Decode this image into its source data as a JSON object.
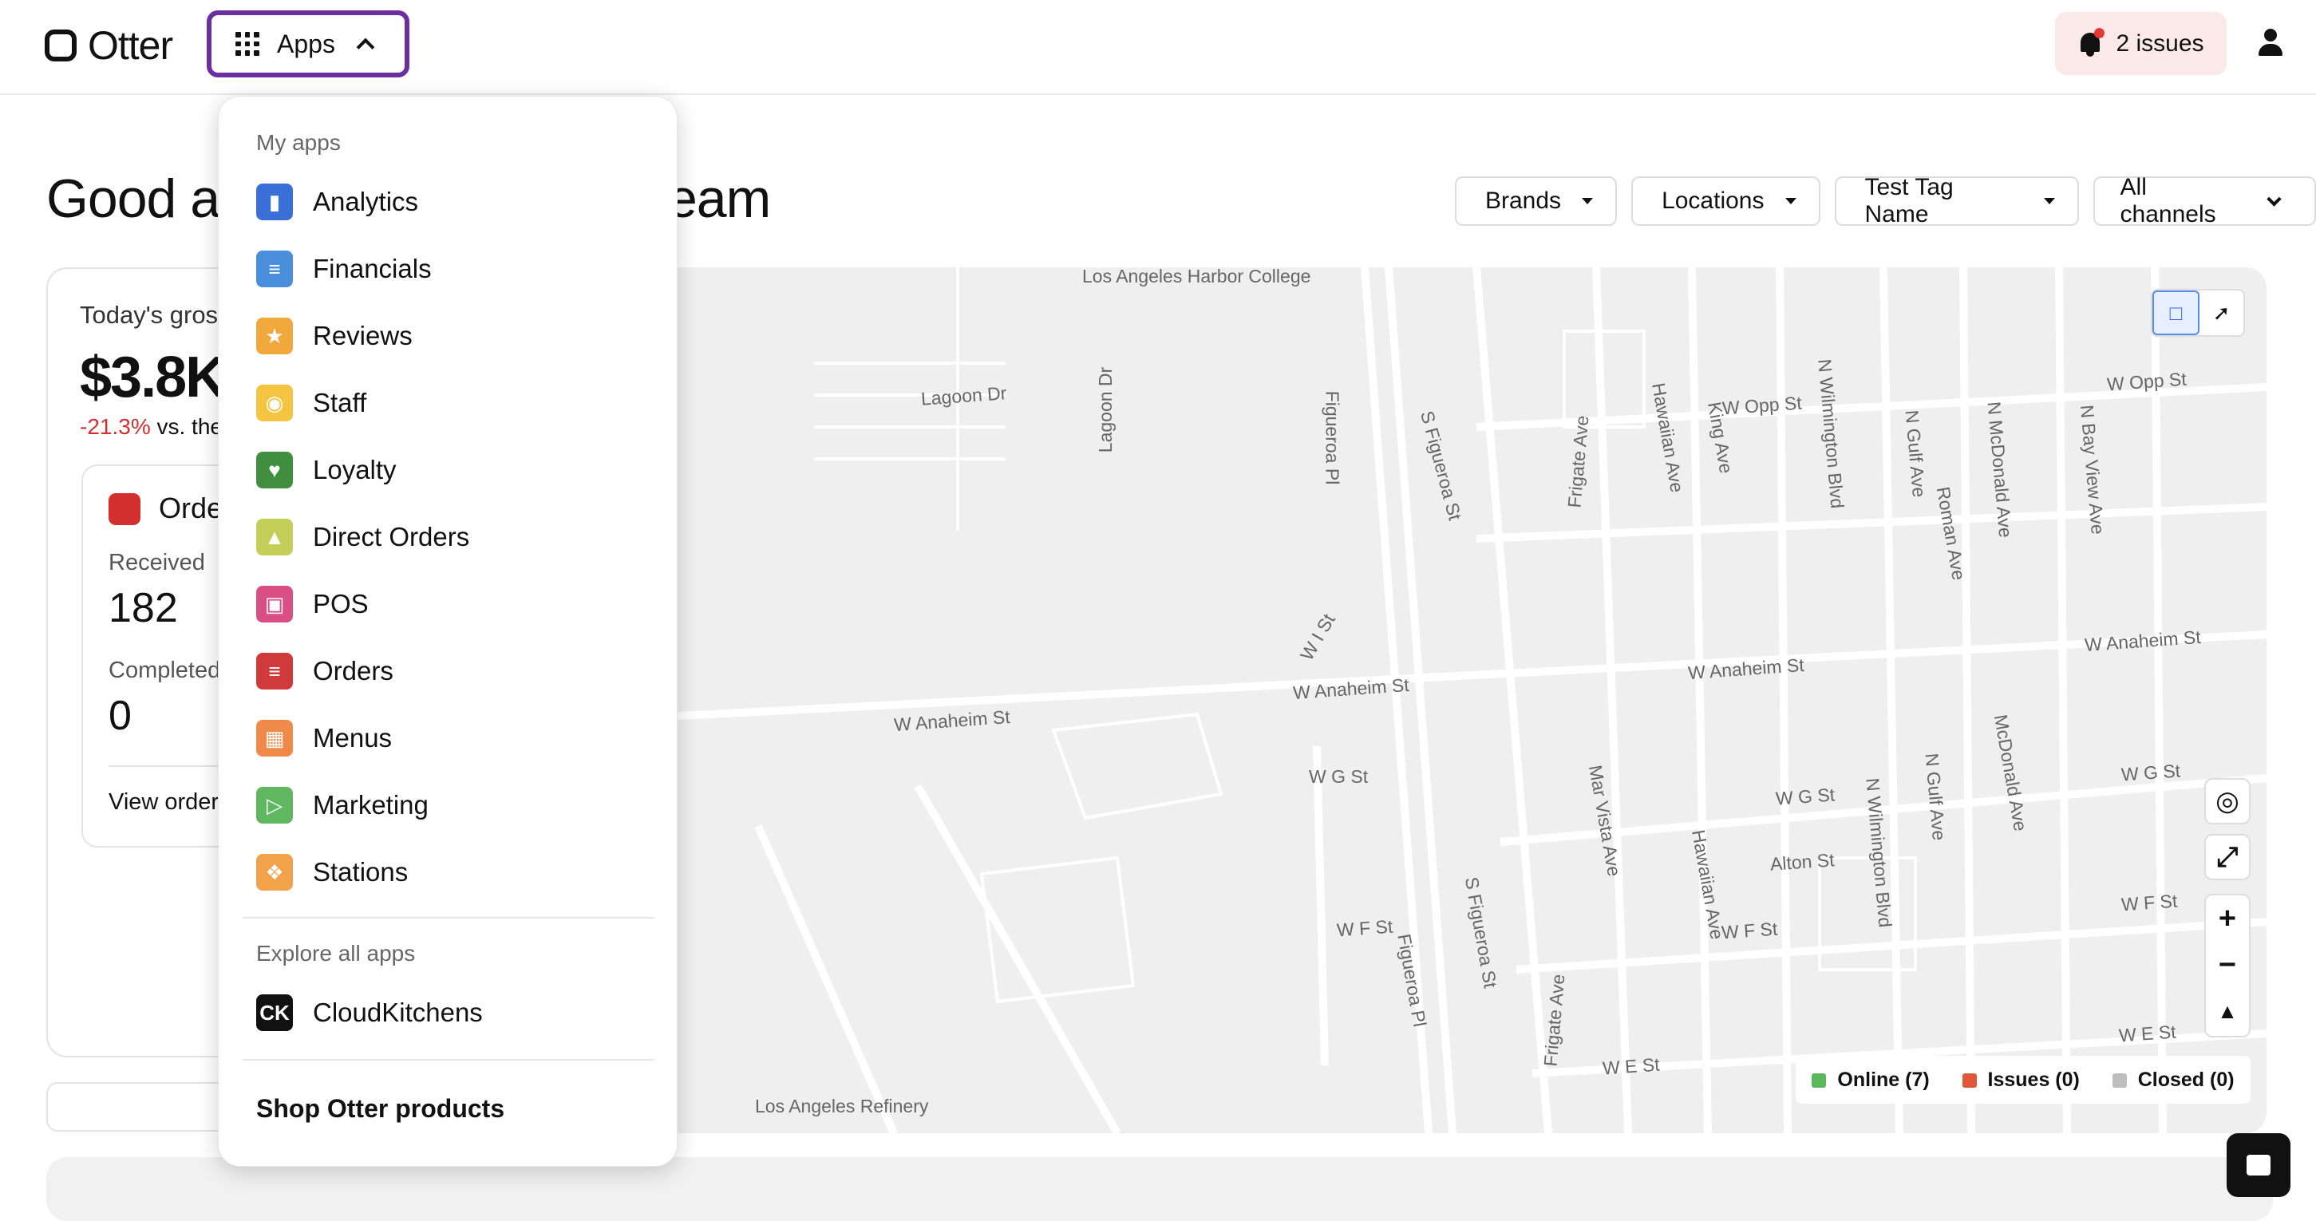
{
  "header": {
    "logo_text": "Otter",
    "apps_label": "Apps",
    "issues_label": "2 issues"
  },
  "greeting": "Good afternoon, Training Team",
  "filters": [
    "Brands",
    "Locations",
    "Test Tag Name",
    "All channels"
  ],
  "summary": {
    "label": "Today's gross sales",
    "value": "$3.8K",
    "change": "-21.3%",
    "change_suffix": "vs. the same day last week"
  },
  "orders_card": {
    "title": "Orders",
    "received_label": "Received",
    "received_value": "182",
    "completed_label": "Completed",
    "completed_value": "0",
    "view_link": "View orders"
  },
  "apps_menu": {
    "my_apps_heading": "My apps",
    "items": [
      {
        "label": "Analytics",
        "icon": "analytics-icon",
        "color": "#3b6fd8"
      },
      {
        "label": "Financials",
        "icon": "financials-icon",
        "color": "#4a8fdb"
      },
      {
        "label": "Reviews",
        "icon": "star-icon",
        "color": "#f2a93b"
      },
      {
        "label": "Staff",
        "icon": "staff-icon",
        "color": "#f5c542"
      },
      {
        "label": "Loyalty",
        "icon": "heart-icon",
        "color": "#3f8f3f"
      },
      {
        "label": "Direct Orders",
        "icon": "cloche-icon",
        "color": "#c4cf5a"
      },
      {
        "label": "POS",
        "icon": "pos-icon",
        "color": "#d94f84"
      },
      {
        "label": "Orders",
        "icon": "orders-icon",
        "color": "#d13a3a"
      },
      {
        "label": "Menus",
        "icon": "menus-icon",
        "color": "#ef8a4a"
      },
      {
        "label": "Marketing",
        "icon": "megaphone-icon",
        "color": "#5fb85f"
      },
      {
        "label": "Stations",
        "icon": "stations-icon",
        "color": "#f2a24a"
      }
    ],
    "explore_heading": "Explore all apps",
    "explore_items": [
      {
        "label": "CloudKitchens",
        "icon": "cloudkitchens-icon",
        "badge": "CK",
        "color": "#111111"
      }
    ],
    "shop_label": "Shop Otter products"
  },
  "map": {
    "labels": [
      "Los Angeles Harbor College",
      "Lagoon Dr",
      "Lagoon Dr",
      "Figueroa Pl",
      "S Figueroa St",
      "Frigate Ave",
      "Hawaiian Ave",
      "King Ave",
      "W Opp St",
      "N Wilmington Blvd",
      "N Gulf Ave",
      "Roman Ave",
      "N McDonald Ave",
      "N Bay View Ave",
      "W Opp St",
      "W I St",
      "W Anaheim St",
      "W Anaheim St",
      "W Anaheim St",
      "W Anaheim St",
      "W G St",
      "W G St",
      "Mar Vista Ave",
      "Hawaiian Ave",
      "Alton St",
      "W G St",
      "McDonald Ave",
      "N Gulf Ave",
      "N Wilmington Blvd",
      "W F St",
      "W F St",
      "W F St",
      "S Figueroa St",
      "Figueroa Pl",
      "Frigate Ave",
      "W E St",
      "W E St",
      "Los Angeles Refinery"
    ],
    "legend": {
      "online": "Online (7)",
      "issues": "Issues (0)",
      "closed": "Closed (0)"
    },
    "legend_colors": {
      "online": "#5cb85c",
      "issues": "#e0583a",
      "closed": "#bdbdbd"
    }
  }
}
